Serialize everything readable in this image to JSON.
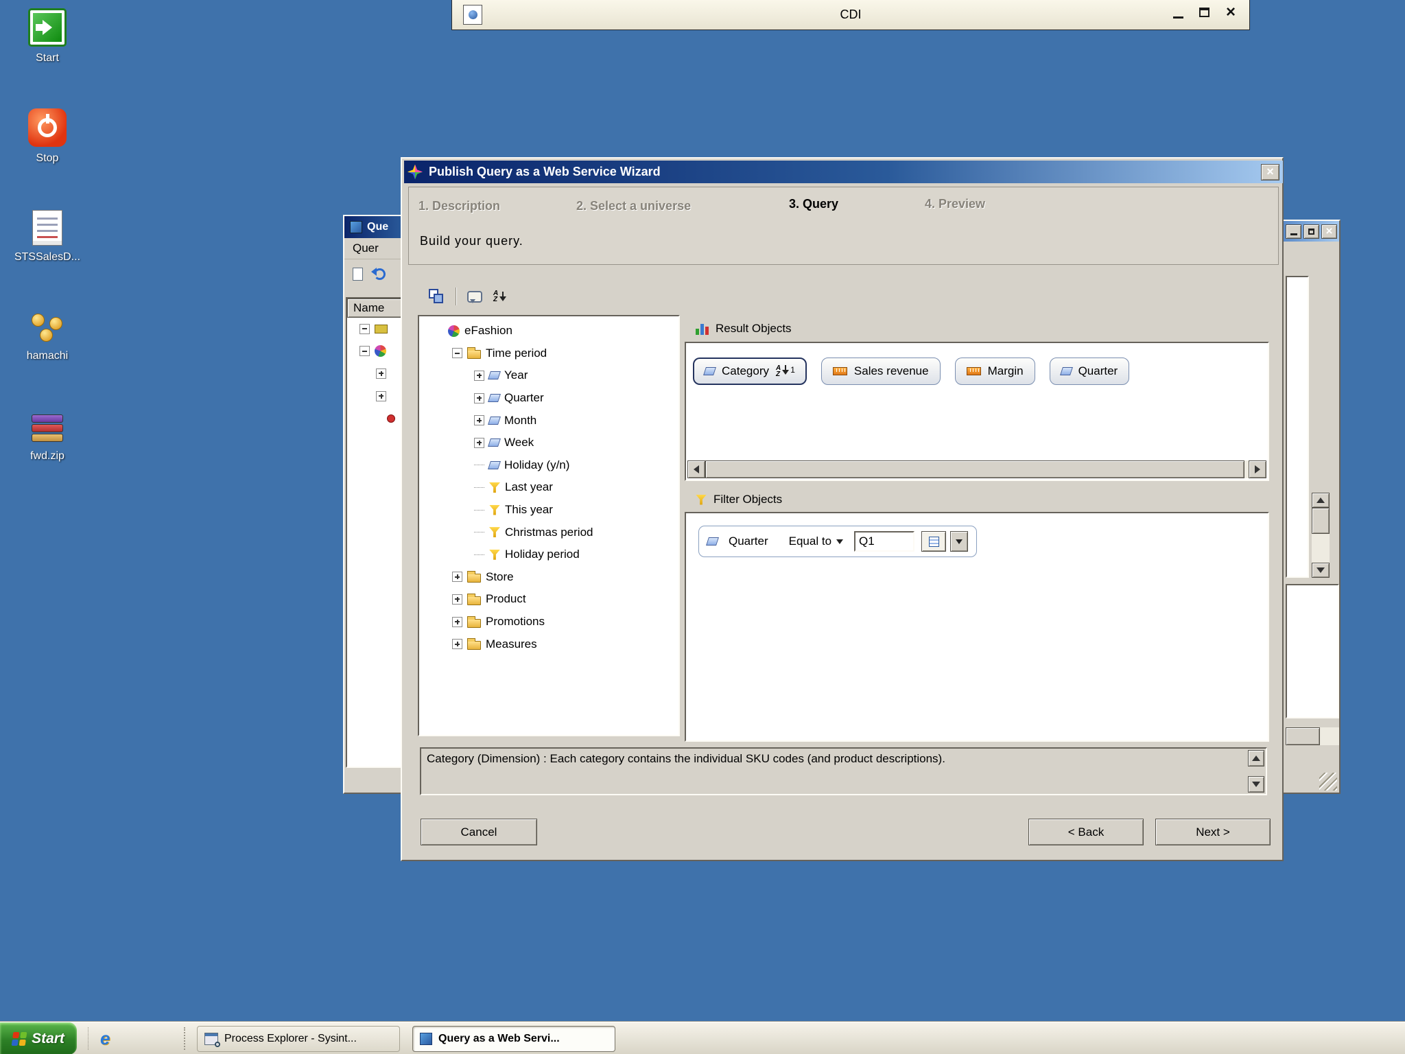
{
  "glyphs": {
    "close": "×",
    "sort_a": "A",
    "sort_z": "Z",
    "ie": "e"
  },
  "desktop": {
    "icons": [
      {
        "label": "Start"
      },
      {
        "label": "Stop"
      },
      {
        "label": "STSSalesD..."
      },
      {
        "label": "hamachi"
      },
      {
        "label": "fwd.zip"
      }
    ]
  },
  "cdi_window": {
    "title": "CDI"
  },
  "query_window": {
    "title": "Que",
    "menu": "Quer",
    "name_header": "Name"
  },
  "wizard": {
    "title": "Publish Query as a Web Service Wizard",
    "steps": [
      {
        "label": "1. Description"
      },
      {
        "label": "2. Select a universe"
      },
      {
        "label": "3. Query"
      },
      {
        "label": "4. Preview"
      }
    ],
    "subtitle": "Build your query.",
    "universe_tree": {
      "items": [
        {
          "label": "eFashion"
        },
        {
          "label": "Time period"
        },
        {
          "label": "Year"
        },
        {
          "label": "Quarter"
        },
        {
          "label": "Month"
        },
        {
          "label": "Week"
        },
        {
          "label": "Holiday (y/n)"
        },
        {
          "label": "Last year"
        },
        {
          "label": "This year"
        },
        {
          "label": "Christmas period"
        },
        {
          "label": "Holiday period"
        },
        {
          "label": "Store"
        },
        {
          "label": "Product"
        },
        {
          "label": "Promotions"
        },
        {
          "label": "Measures"
        }
      ]
    },
    "result_objects": {
      "label": "Result Objects",
      "chips": [
        {
          "label": "Category",
          "sort_order": "1"
        },
        {
          "label": "Sales revenue"
        },
        {
          "label": "Margin"
        },
        {
          "label": "Quarter"
        }
      ]
    },
    "filter_objects": {
      "label": "Filter Objects",
      "filter": {
        "object": "Quarter",
        "operator": "Equal to",
        "value": "Q1"
      }
    },
    "description": "Category (Dimension) : Each category contains the individual SKU codes (and product descriptions).",
    "buttons": {
      "cancel": "Cancel",
      "back": "< Back",
      "next": "Next >"
    }
  },
  "taskbar": {
    "start_label": "Start",
    "tasks": [
      {
        "label": "Process Explorer - Sysint...",
        "active": false
      },
      {
        "label": "Query as a Web Servi...",
        "active": true
      }
    ]
  }
}
